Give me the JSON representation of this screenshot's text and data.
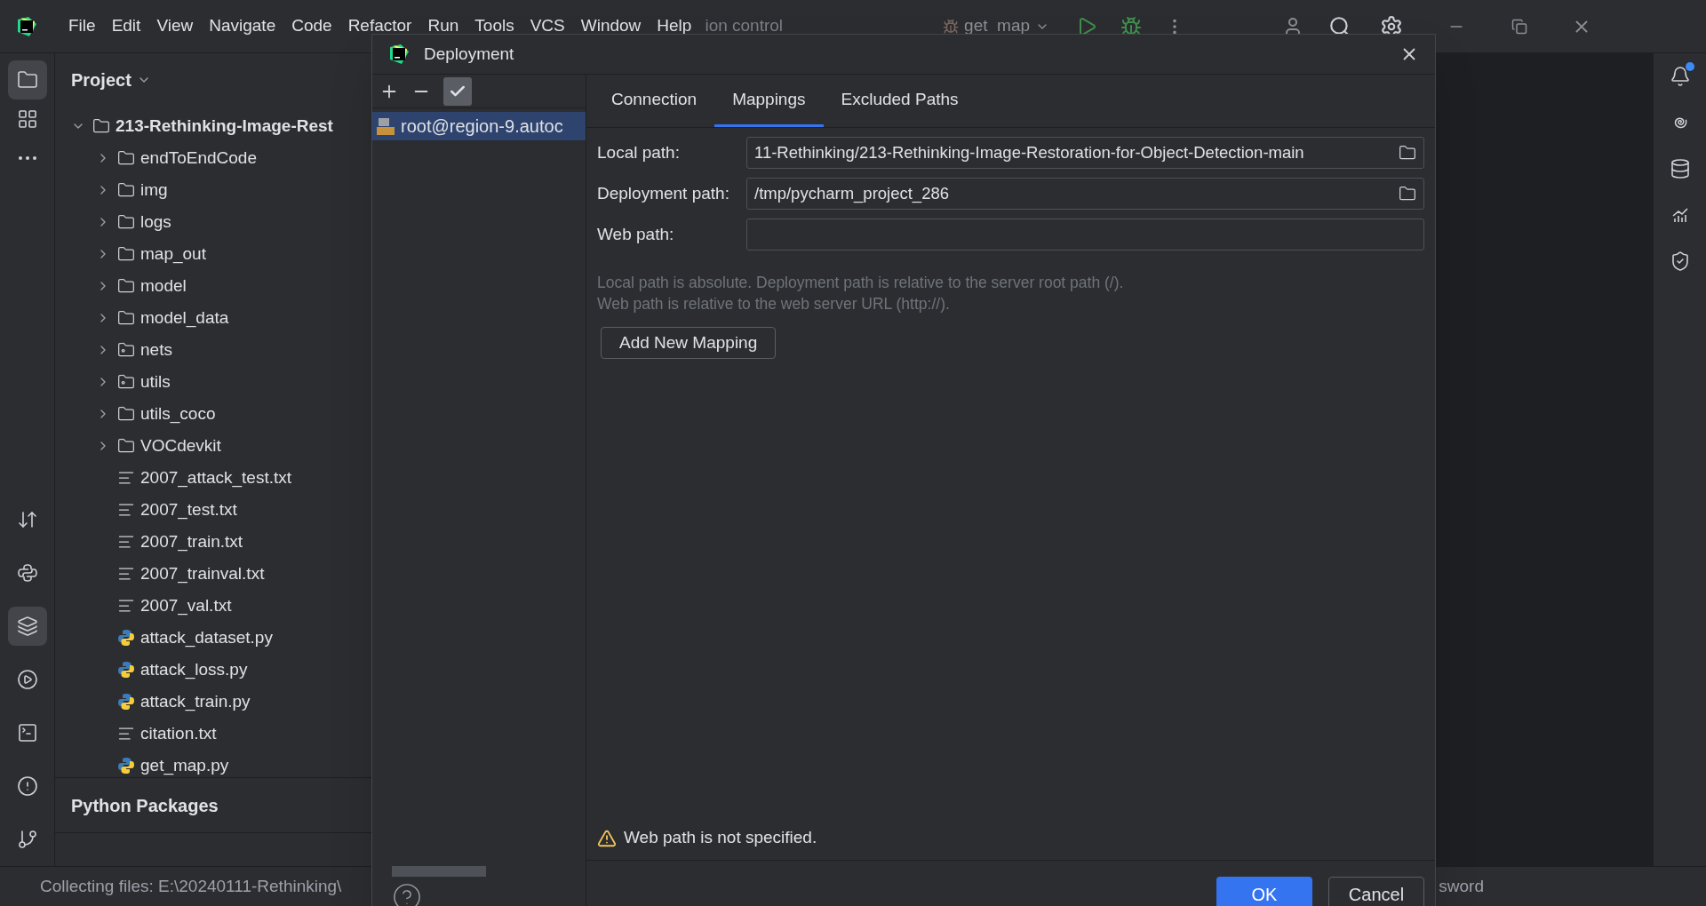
{
  "menu": [
    {
      "label": "File"
    },
    {
      "label": "Edit"
    },
    {
      "label": "View"
    },
    {
      "label": "Navigate"
    },
    {
      "label": "Code"
    },
    {
      "label": "Refactor"
    },
    {
      "label": "Run"
    },
    {
      "label": "Tools"
    },
    {
      "label": "VCS"
    },
    {
      "label": "Window"
    },
    {
      "label": "Help"
    }
  ],
  "menu_tail": "ion control",
  "run_config": "get_map",
  "left_tools": [
    {
      "kind": "project",
      "selected": true
    },
    {
      "kind": "structure",
      "selected": false
    },
    {
      "kind": "more",
      "selected": false
    },
    {
      "kind": "transfer",
      "selected": false
    },
    {
      "kind": "python",
      "selected": false
    },
    {
      "kind": "layers",
      "selected": true
    },
    {
      "kind": "services",
      "selected": false
    },
    {
      "kind": "terminal",
      "selected": false
    },
    {
      "kind": "problems",
      "selected": false
    },
    {
      "kind": "git",
      "selected": false
    }
  ],
  "project_panel": {
    "title": "Project",
    "tree": [
      {
        "label": "213-Rethinking-Image-Rest",
        "kind": "folder",
        "expanded": true,
        "children": [
          {
            "label": "endToEndCode",
            "kind": "folder",
            "expanded": false
          },
          {
            "label": "img",
            "kind": "folder",
            "expanded": false
          },
          {
            "label": "logs",
            "kind": "folder",
            "expanded": false
          },
          {
            "label": "map_out",
            "kind": "folder",
            "expanded": false
          },
          {
            "label": "model",
            "kind": "folder",
            "expanded": false
          },
          {
            "label": "model_data",
            "kind": "folder",
            "expanded": false
          },
          {
            "label": "nets",
            "kind": "package",
            "expanded": false
          },
          {
            "label": "utils",
            "kind": "package",
            "expanded": false
          },
          {
            "label": "utils_coco",
            "kind": "folder",
            "expanded": false
          },
          {
            "label": "VOCdevkit",
            "kind": "folder",
            "expanded": false
          },
          {
            "label": "2007_attack_test.txt",
            "kind": "text"
          },
          {
            "label": "2007_test.txt",
            "kind": "text"
          },
          {
            "label": "2007_train.txt",
            "kind": "text"
          },
          {
            "label": "2007_trainval.txt",
            "kind": "text"
          },
          {
            "label": "2007_val.txt",
            "kind": "text"
          },
          {
            "label": "attack_dataset.py",
            "kind": "python"
          },
          {
            "label": "attack_loss.py",
            "kind": "python"
          },
          {
            "label": "attack_train.py",
            "kind": "python"
          },
          {
            "label": "citation.txt",
            "kind": "text"
          },
          {
            "label": "get_map.py",
            "kind": "python"
          }
        ]
      }
    ]
  },
  "python_packages": "Python Packages",
  "right_tools": [
    {
      "kind": "notifications",
      "badge": true
    },
    {
      "kind": "spiral",
      "badge": false
    },
    {
      "kind": "database",
      "badge": false
    },
    {
      "kind": "chart",
      "badge": false
    },
    {
      "kind": "shield",
      "badge": false
    }
  ],
  "status_bar": {
    "text": "Collecting files: E:\\20240111-Rethinking\\",
    "right": "sword"
  },
  "dialog": {
    "title": "Deployment",
    "servers": [
      {
        "label": "root@region-9.autoc",
        "selected": true
      }
    ],
    "tabs": [
      {
        "label": "Connection",
        "selected": false
      },
      {
        "label": "Mappings",
        "selected": true
      },
      {
        "label": "Excluded Paths",
        "selected": false
      }
    ],
    "fields": [
      {
        "label": "Local path:",
        "value": "11-Rethinking/213-Rethinking-Image-Restoration-for-Object-Detection-main",
        "browse": true
      },
      {
        "label": "Deployment path:",
        "value": "/tmp/pycharm_project_286",
        "browse": true
      },
      {
        "label": "Web path:",
        "browse": false
      }
    ],
    "hints": [
      "Local path is absolute. Deployment path is relative to the server root path (/).",
      "Web path is relative to the web server URL (http://)."
    ],
    "add_button": "Add New Mapping",
    "warning": "Web path is not specified.",
    "buttons": [
      {
        "label": "OK",
        "default": true
      },
      {
        "label": "Cancel",
        "default": false
      }
    ]
  }
}
